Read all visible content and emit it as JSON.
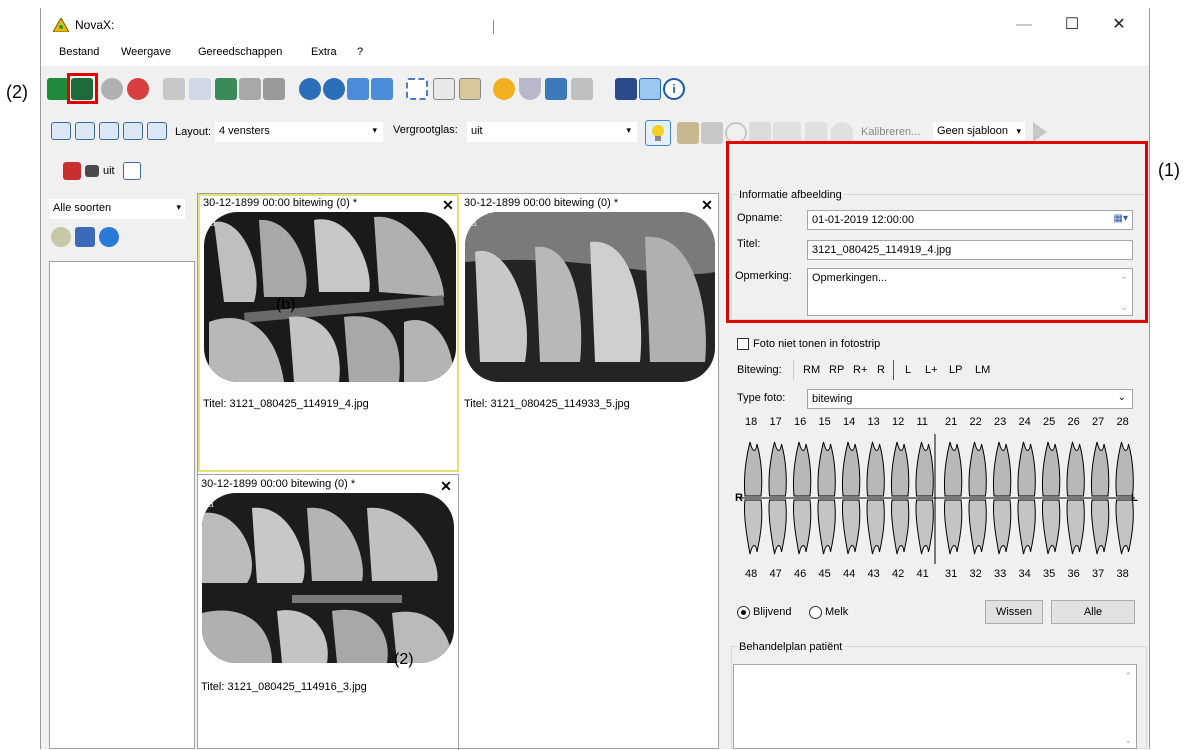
{
  "window": {
    "title": "NovaX:",
    "min": "—",
    "max": "☐",
    "close": "✕"
  },
  "menu": [
    "Bestand",
    "Weergave",
    "Gereedschappen",
    "Extra",
    "?"
  ],
  "toolbar2": {
    "layout_label": "Layout:",
    "layout_value": "4 vensters",
    "zoom_label": "Vergrootglas:",
    "zoom_value": "uit",
    "calibrate": "Kalibreren...",
    "template_value": "Geen sjabloon"
  },
  "toolbar3": {
    "toggle": "uit"
  },
  "left_panel": {
    "filter": "Alle soorten"
  },
  "images": [
    {
      "header": "30-12-1899 00:00 bitewing (0) *",
      "caption": "Titel: 3121_080425_114919_4.jpg"
    },
    {
      "header": "30-12-1899 00:00 bitewing (0) *",
      "caption": "Titel: 3121_080425_114933_5.jpg"
    },
    {
      "header": "30-12-1899 00:00 bitewing (0) *",
      "caption": "Titel: 3121_080425_114916_3.jpg"
    }
  ],
  "info": {
    "group": "Informatie afbeelding",
    "date_label": "Opname:",
    "date_value": "01-01-2019 12:00:00",
    "title_label": "Titel:",
    "title_value": "3121_080425_114919_4.jpg",
    "remark_label": "Opmerking:",
    "remark_value": "Opmerkingen..."
  },
  "details": {
    "hide_label": "Foto niet tonen in fotostrip",
    "bitewing_label": "Bitewing:",
    "bitewing_opts": [
      "RM",
      "RP",
      "R+",
      "R",
      "L",
      "L+",
      "LP",
      "LM"
    ],
    "type_label": "Type foto:",
    "type_value": "bitewing",
    "upper_nums": [
      "18",
      "17",
      "16",
      "15",
      "14",
      "13",
      "12",
      "11",
      "21",
      "22",
      "23",
      "24",
      "25",
      "26",
      "27",
      "28"
    ],
    "lower_nums": [
      "48",
      "47",
      "46",
      "45",
      "44",
      "43",
      "42",
      "41",
      "31",
      "32",
      "33",
      "34",
      "35",
      "36",
      "37",
      "38"
    ],
    "side_left": "R",
    "side_right": "L",
    "radio_perm": "Blijvend",
    "radio_milk": "Melk",
    "clear": "Wissen",
    "all": "Alle"
  },
  "plan": {
    "title": "Behandelplan patiënt"
  },
  "annotations": {
    "a1": "(1)",
    "a2": "(2)",
    "img_a": "(b)",
    "img_b": "(2)",
    "img_marker": "a"
  }
}
